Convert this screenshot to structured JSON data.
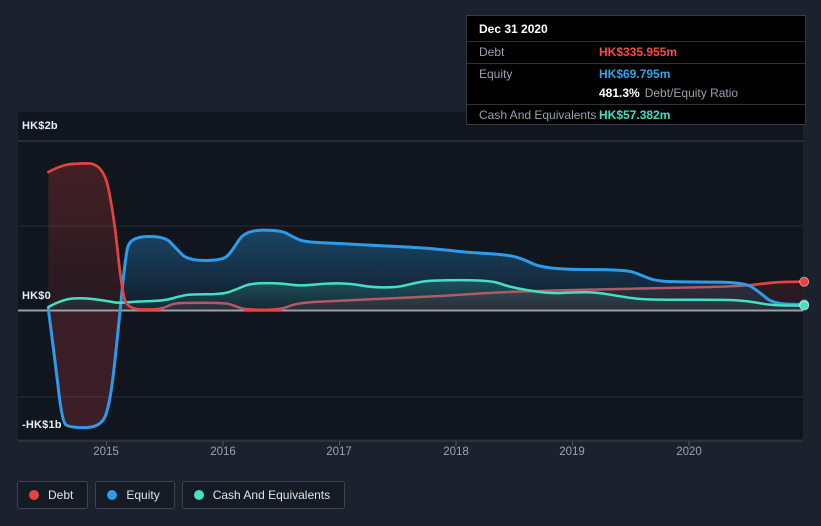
{
  "tooltip": {
    "date": "Dec 31 2020",
    "rows": {
      "debt": {
        "label": "Debt",
        "value": "HK$335.955m"
      },
      "equity": {
        "label": "Equity",
        "value": "HK$69.795m"
      },
      "ratio": {
        "pct": "481.3%",
        "label": "Debt/Equity Ratio"
      },
      "cash": {
        "label": "Cash And Equivalents",
        "value": "HK$57.382m"
      }
    }
  },
  "legend": {
    "position": "bottom-left",
    "items": [
      {
        "key": "debt",
        "label": "Debt"
      },
      {
        "key": "equity",
        "label": "Equity"
      },
      {
        "key": "cash",
        "label": "Cash And Equivalents"
      }
    ]
  },
  "colors": {
    "debt": "#e8423c",
    "debt_muted": "#b25866",
    "equity": "#2d9ce8",
    "cash": "#45e0c2",
    "background": "#1b222d",
    "plot_background": "#10151e",
    "zero_line": "#9aa0a7",
    "negative_equity_fill": "rgba(216,62,76,0.22)"
  },
  "axis": {
    "y_labels": [
      {
        "text": "HK$2b",
        "value": 2
      },
      {
        "text": "HK$0",
        "value": 0
      },
      {
        "text": "-HK$1b",
        "value": -1
      }
    ],
    "x_labels": [
      "2015",
      "2016",
      "2017",
      "2018",
      "2019",
      "2020"
    ]
  },
  "chart_data": {
    "type": "area",
    "title": "Debt, Equity and Cash history (hover: Dec 31 2020)",
    "x_unit": "year",
    "x_range": [
      2014.5,
      2020.98
    ],
    "y_unit": "HK$ billions",
    "y_ticks": [
      2,
      1,
      0,
      -1
    ],
    "grid": true,
    "legend_position": "bottom-left",
    "series": [
      {
        "key": "debt",
        "name": "Debt",
        "points": [
          [
            2014.5,
            1.62
          ],
          [
            2014.6,
            1.69
          ],
          [
            2014.72,
            1.72
          ],
          [
            2014.97,
            1.72
          ],
          [
            2015.06,
            1.15
          ],
          [
            2015.13,
            0.25
          ],
          [
            2015.18,
            0.01
          ],
          [
            2015.46,
            0.01
          ],
          [
            2015.56,
            0.075
          ],
          [
            2015.65,
            0.09
          ],
          [
            2016.02,
            0.09
          ],
          [
            2016.1,
            0.055
          ],
          [
            2016.19,
            0.008
          ],
          [
            2016.5,
            0.008
          ],
          [
            2016.63,
            0.09
          ],
          [
            2017.0,
            0.115
          ],
          [
            2017.4,
            0.14
          ],
          [
            2017.8,
            0.165
          ],
          [
            2018.0,
            0.18
          ],
          [
            2018.2,
            0.2
          ],
          [
            2018.5,
            0.22
          ],
          [
            2018.9,
            0.235
          ],
          [
            2019.3,
            0.25
          ],
          [
            2019.7,
            0.26
          ],
          [
            2020.1,
            0.27
          ],
          [
            2020.4,
            0.285
          ],
          [
            2020.55,
            0.3
          ],
          [
            2020.75,
            0.333
          ],
          [
            2020.98,
            0.336
          ]
        ]
      },
      {
        "key": "equity",
        "name": "Equity",
        "points": [
          [
            2014.5,
            0.02
          ],
          [
            2014.56,
            -0.6
          ],
          [
            2014.62,
            -1.3
          ],
          [
            2014.68,
            -1.37
          ],
          [
            2014.95,
            -1.37
          ],
          [
            2015.03,
            -1.1
          ],
          [
            2015.1,
            -0.25
          ],
          [
            2015.16,
            0.6
          ],
          [
            2015.2,
            0.86
          ],
          [
            2015.5,
            0.87
          ],
          [
            2015.6,
            0.72
          ],
          [
            2015.7,
            0.585
          ],
          [
            2016.0,
            0.585
          ],
          [
            2016.08,
            0.7
          ],
          [
            2016.19,
            0.94
          ],
          [
            2016.5,
            0.94
          ],
          [
            2016.6,
            0.86
          ],
          [
            2016.7,
            0.8
          ],
          [
            2017.0,
            0.785
          ],
          [
            2017.3,
            0.76
          ],
          [
            2017.6,
            0.745
          ],
          [
            2017.9,
            0.71
          ],
          [
            2018.1,
            0.68
          ],
          [
            2018.4,
            0.655
          ],
          [
            2018.55,
            0.62
          ],
          [
            2018.76,
            0.48
          ],
          [
            2019.45,
            0.48
          ],
          [
            2019.58,
            0.42
          ],
          [
            2019.72,
            0.34
          ],
          [
            2020.0,
            0.335
          ],
          [
            2020.48,
            0.33
          ],
          [
            2020.6,
            0.22
          ],
          [
            2020.72,
            0.08
          ],
          [
            2020.98,
            0.0698
          ]
        ]
      },
      {
        "key": "cash",
        "name": "Cash And Equivalents",
        "points": [
          [
            2014.5,
            0.04
          ],
          [
            2014.62,
            0.13
          ],
          [
            2014.8,
            0.15
          ],
          [
            2015.0,
            0.115
          ],
          [
            2015.1,
            0.085
          ],
          [
            2015.25,
            0.105
          ],
          [
            2015.5,
            0.115
          ],
          [
            2015.62,
            0.165
          ],
          [
            2015.72,
            0.19
          ],
          [
            2016.0,
            0.19
          ],
          [
            2016.12,
            0.25
          ],
          [
            2016.24,
            0.32
          ],
          [
            2016.5,
            0.32
          ],
          [
            2016.66,
            0.285
          ],
          [
            2016.9,
            0.32
          ],
          [
            2017.1,
            0.315
          ],
          [
            2017.28,
            0.27
          ],
          [
            2017.5,
            0.27
          ],
          [
            2017.65,
            0.325
          ],
          [
            2017.8,
            0.355
          ],
          [
            2018.3,
            0.355
          ],
          [
            2018.45,
            0.28
          ],
          [
            2018.62,
            0.235
          ],
          [
            2018.8,
            0.2
          ],
          [
            2019.0,
            0.21
          ],
          [
            2019.2,
            0.215
          ],
          [
            2019.45,
            0.155
          ],
          [
            2019.6,
            0.13
          ],
          [
            2019.9,
            0.125
          ],
          [
            2020.3,
            0.125
          ],
          [
            2020.5,
            0.115
          ],
          [
            2020.7,
            0.06
          ],
          [
            2020.98,
            0.057
          ]
        ]
      }
    ]
  }
}
